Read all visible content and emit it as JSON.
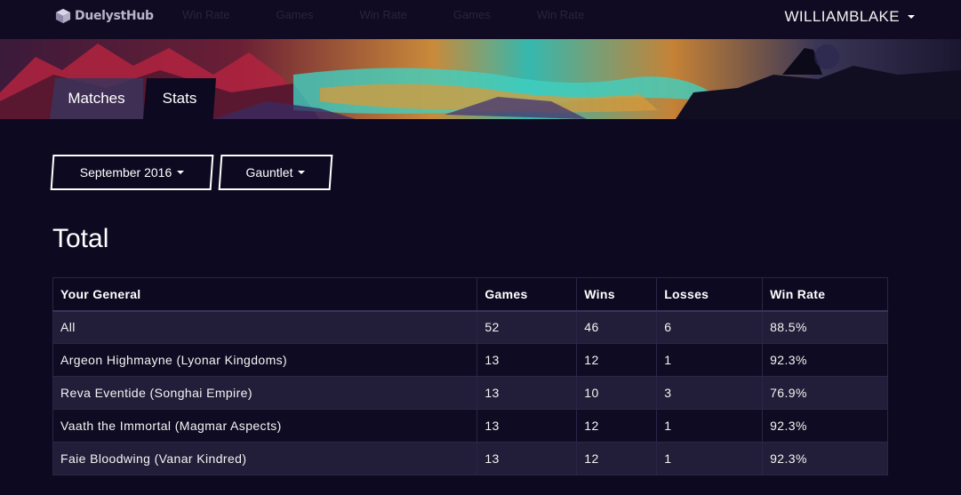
{
  "nav": {
    "logo_text": "DuelystHub",
    "links": [
      "Win Rate",
      "Games",
      "Win Rate",
      "Games",
      "Win Rate"
    ],
    "user_name": "WILLIAMBLAKE"
  },
  "tabs": [
    "Matches",
    "Stats"
  ],
  "active_tab": "Stats",
  "filters": {
    "month": "September 2016",
    "mode": "Gauntlet"
  },
  "section_title": "Total",
  "table": {
    "headers": [
      "Your General",
      "Games",
      "Wins",
      "Losses",
      "Win Rate"
    ],
    "rows": [
      [
        "All",
        "52",
        "46",
        "6",
        "88.5%"
      ],
      [
        "Argeon Highmayne (Lyonar Kingdoms)",
        "13",
        "12",
        "1",
        "92.3%"
      ],
      [
        "Reva Eventide (Songhai Empire)",
        "13",
        "10",
        "3",
        "76.9%"
      ],
      [
        "Vaath the Immortal (Magmar Aspects)",
        "13",
        "12",
        "1",
        "92.3%"
      ],
      [
        "Faie Bloodwing (Vanar Kindred)",
        "13",
        "12",
        "1",
        "92.3%"
      ]
    ]
  },
  "colors": {
    "background": "#0d0920",
    "row_alt": "#221d38",
    "border": "#2c2547"
  }
}
